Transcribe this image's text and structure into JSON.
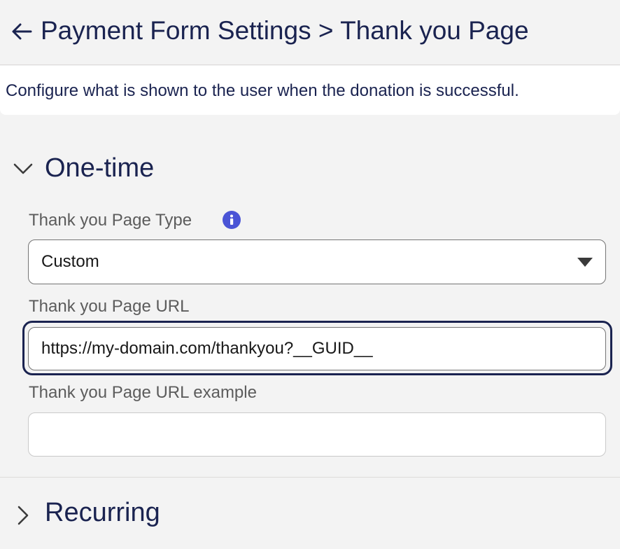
{
  "header": {
    "back_icon": "arrow-left-icon",
    "title": "Payment Form Settings > Thank you Page"
  },
  "description": "Configure what is shown to the user when the donation is successful.",
  "sections": {
    "one_time": {
      "title": "One-time",
      "expanded": true,
      "chevron_icon": "chevron-down-icon",
      "page_type": {
        "label": "Thank you Page Type",
        "info_icon": "info-icon",
        "selected": "Custom"
      },
      "page_url": {
        "label": "Thank you Page URL",
        "value": "https://my-domain.com/thankyou?__GUID__",
        "focused": true
      },
      "page_url_example": {
        "label": "Thank you Page URL example",
        "value": ""
      }
    },
    "recurring": {
      "title": "Recurring",
      "expanded": false,
      "chevron_icon": "chevron-right-icon"
    }
  },
  "colors": {
    "text_primary": "#1a2350",
    "label_gray": "#5c5c5c",
    "info_icon": "#4a54d6",
    "background": "#f3f3f3",
    "focus_ring": "#1a2350"
  }
}
